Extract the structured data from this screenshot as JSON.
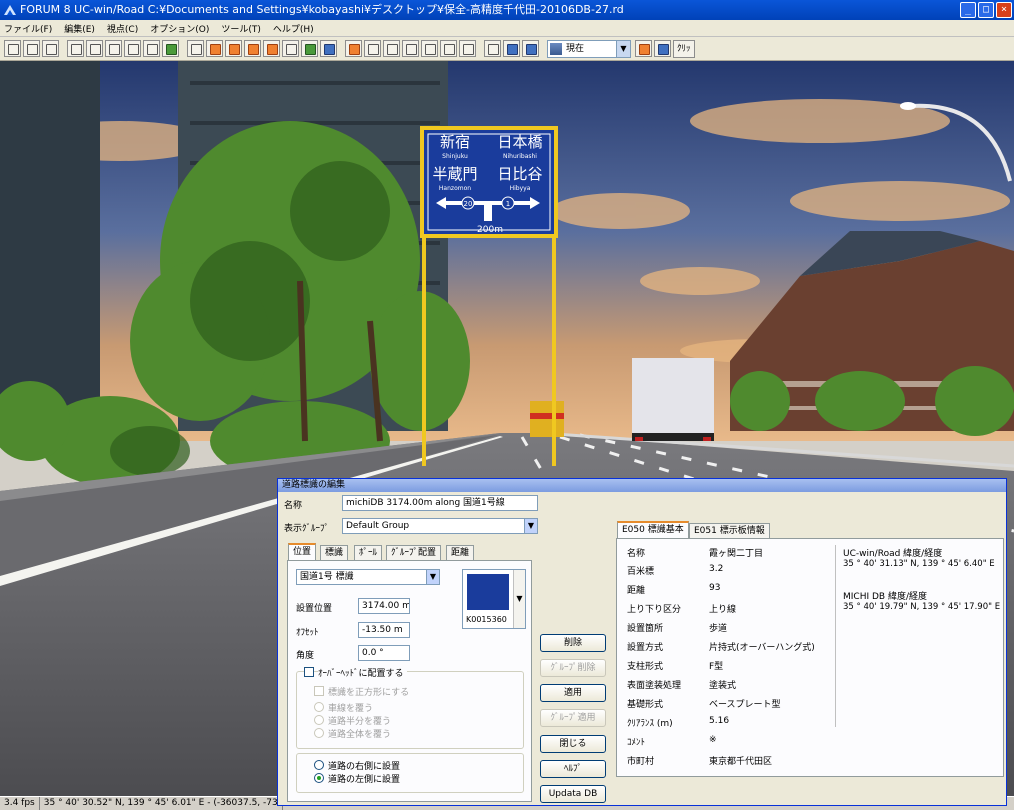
{
  "window": {
    "title": "FORUM 8    UC-win/Road    C:¥Documents and Settings¥kobayashi¥デスクトップ¥保全-高精度千代田-20106DB-27.rd",
    "min_glyph": "_",
    "max_glyph": "□",
    "close_glyph": "×"
  },
  "menu": [
    "ファイル(F)",
    "編集(E)",
    "視点(C)",
    "オプション(O)",
    "ツール(T)",
    "ヘルプ(H)"
  ],
  "toolbar": {
    "view_select": "現在",
    "text_button": "ｸﾘｯ"
  },
  "scene": {
    "sign": {
      "row1_left": "新宿",
      "row1_left_en": "Shinjuku",
      "row1_right": "日本橋",
      "row1_right_en": "Nihuribashi",
      "row2_left": "半蔵門",
      "row2_left_en": "Hanzomon",
      "row2_right": "日比谷",
      "row2_right_en": "Hibyya",
      "route_left": "20",
      "route_right": "1",
      "distance": "200m"
    }
  },
  "status": {
    "fps": "3.4 fps",
    "coords": "35 °  40' 30.52\" N, 139 °  45' 6.01\" E  -  (-36037.5, -73"
  },
  "dialog": {
    "title": "道路標識の編集",
    "name_label": "名称",
    "name_value": "michiDB 3174.00m along 国道1号線",
    "group_label": "表示ｸﾞﾙｰﾌﾟ",
    "group_value": "Default Group",
    "tabs": [
      "位置",
      "標識",
      "ﾎﾟｰﾙ",
      "ｸﾞﾙｰﾌﾟ配置",
      "距離"
    ],
    "road_select": "国道1号  標識",
    "position_label": "設置位置",
    "position_value": "3174.00 m",
    "offset_label": "ｵﾌｾｯﾄ",
    "offset_value": "-13.50 m",
    "angle_label": "角度",
    "angle_value": "0.0 °",
    "thumb_code": "K0015360",
    "overhead_label": "ｵｰﾊﾞｰﾍｯﾄﾞに配置する",
    "square_label": "標識を正方形にする",
    "overhead_options": [
      "車線を覆う",
      "道路半分を覆う",
      "道路全体を覆う"
    ],
    "side_options": [
      "道路の右側に設置",
      "道路の左側に設置"
    ],
    "buttons": {
      "delete": "削除",
      "group_delete": "ｸﾞﾙｰﾌﾟ削除",
      "apply": "適用",
      "group_apply": "ｸﾞﾙｰﾌﾟ適用",
      "close": "閉じる",
      "help": "ﾍﾙﾌﾟ",
      "update": "Updata DB"
    },
    "info_tabs": [
      "E050  標識基本",
      "E051  標示板情報"
    ],
    "info_rows": [
      {
        "k": "名称",
        "v": "霞ヶ関二丁目"
      },
      {
        "k": "百米標",
        "v": "3.2"
      },
      {
        "k": "距離",
        "v": "93"
      },
      {
        "k": "上り下り区分",
        "v": "上り線"
      },
      {
        "k": "設置箇所",
        "v": "歩道"
      },
      {
        "k": "設置方式",
        "v": "片持式(オーバーハング式)"
      },
      {
        "k": "支柱形式",
        "v": "F型"
      },
      {
        "k": "表面塗装処理",
        "v": "塗装式"
      },
      {
        "k": "基礎形式",
        "v": "ベースプレート型"
      },
      {
        "k": "ｸﾘｱﾗﾝｽ (m)",
        "v": "5.16"
      },
      {
        "k": "ｺﾒﾝﾄ",
        "v": "※"
      },
      {
        "k": "市町村",
        "v": "東京都千代田区"
      }
    ],
    "coords": {
      "ucwin_label": "UC-win/Road 緯度/経度",
      "ucwin_value": "35 °  40' 31.13\" N, 139 °  45' 6.40\" E",
      "michi_label": "MICHI DB 緯度/経度",
      "michi_value": "35 °  40' 19.79\" N, 139 °  45' 17.90\" E"
    }
  }
}
